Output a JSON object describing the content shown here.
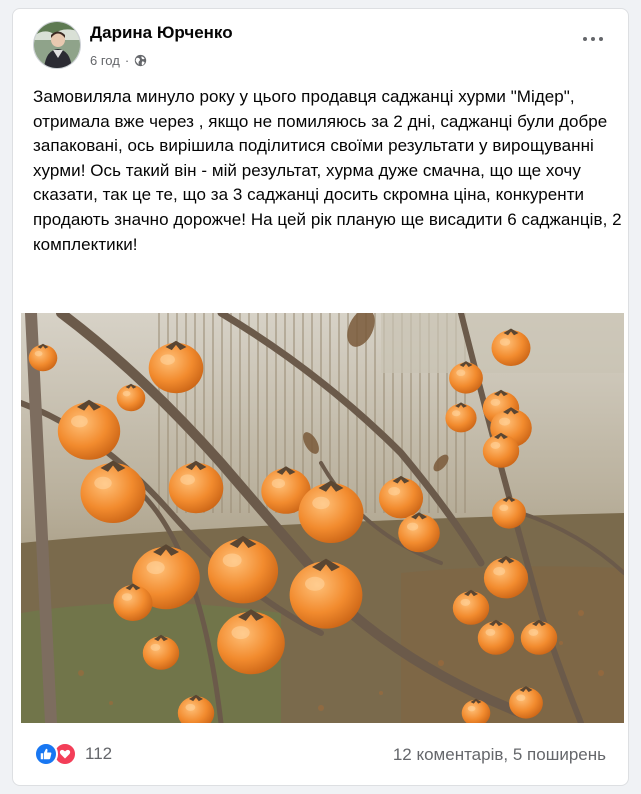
{
  "post": {
    "author": "Дарина Юрченко",
    "time": "6 год",
    "separator": "·",
    "privacy_icon": "globe-icon",
    "more_icon": "more-options-icon",
    "text": "Замовиляла минуло року у цього продавця саджанці хурми \"Мідер\", отримала вже через , якщо не помиляюсь за 2 дні, саджанці були добре запаковані, ось вирішила поділитися своїми результати у вирощуванні хурми! Ось такий він - мій результат, хурма дуже смачна, що ще хочу сказати, так це те, що за 3 саджанці досить скромна ціна, конкуренти продають значно дорожче! На цей рік планую ще висадити 6 саджанців, 2 комплектики!",
    "image": "photo of persimmon tree branches with ripe orange fruit"
  },
  "footer": {
    "reaction_icons": [
      "like-icon",
      "love-icon"
    ],
    "reaction_count": "112",
    "comments": "12 коментарів",
    "stats_separator": ", ",
    "shares": "5 поширень"
  },
  "colors": {
    "like": "#1877f2",
    "love": "#f33e58",
    "secondary_text": "#65676b",
    "fruit": "#f08a2c"
  }
}
